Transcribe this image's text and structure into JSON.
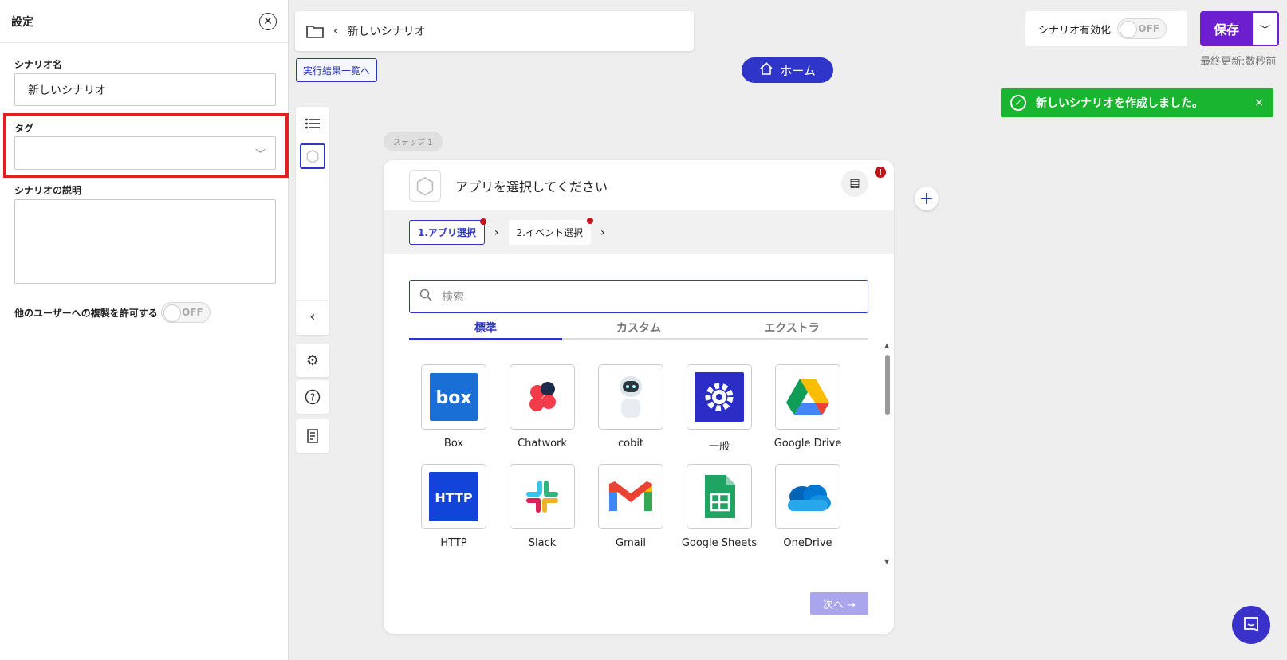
{
  "settings": {
    "title": "設定",
    "scenario_name_label": "シナリオ名",
    "scenario_name_value": "新しいシナリオ",
    "tag_label": "タグ",
    "description_label": "シナリオの説明",
    "allow_copy_label": "他のユーザーへの複製を許可する",
    "allow_copy_toggle": "OFF"
  },
  "topbar": {
    "scenario_name": "新しいシナリオ",
    "results_link": "実行結果一覧へ",
    "home": "ホーム",
    "enable_label": "シナリオ有効化",
    "enable_toggle": "OFF",
    "save": "保存",
    "last_updated": "最終更新:数秒前"
  },
  "toast": {
    "message": "新しいシナリオを作成しました。",
    "close": "×"
  },
  "canvas": {
    "step_badge": "ステップ 1",
    "card_title": "アプリを選択してください",
    "error_mark": "!",
    "steps": [
      "1.アプリ選択",
      "2.イベント選択"
    ],
    "search_placeholder": "検索",
    "tabs": [
      "標準",
      "カスタム",
      "エクストラ"
    ],
    "apps": [
      "Box",
      "Chatwork",
      "cobit",
      "一般",
      "Google Drive",
      "HTTP",
      "Slack",
      "Gmail",
      "Google Sheets",
      "OneDrive"
    ],
    "next": "次へ →"
  },
  "colors": {
    "accent": "#2f35c9",
    "save": "#6d1fd0",
    "toast": "#19b52e",
    "highlight": "#e32020"
  }
}
